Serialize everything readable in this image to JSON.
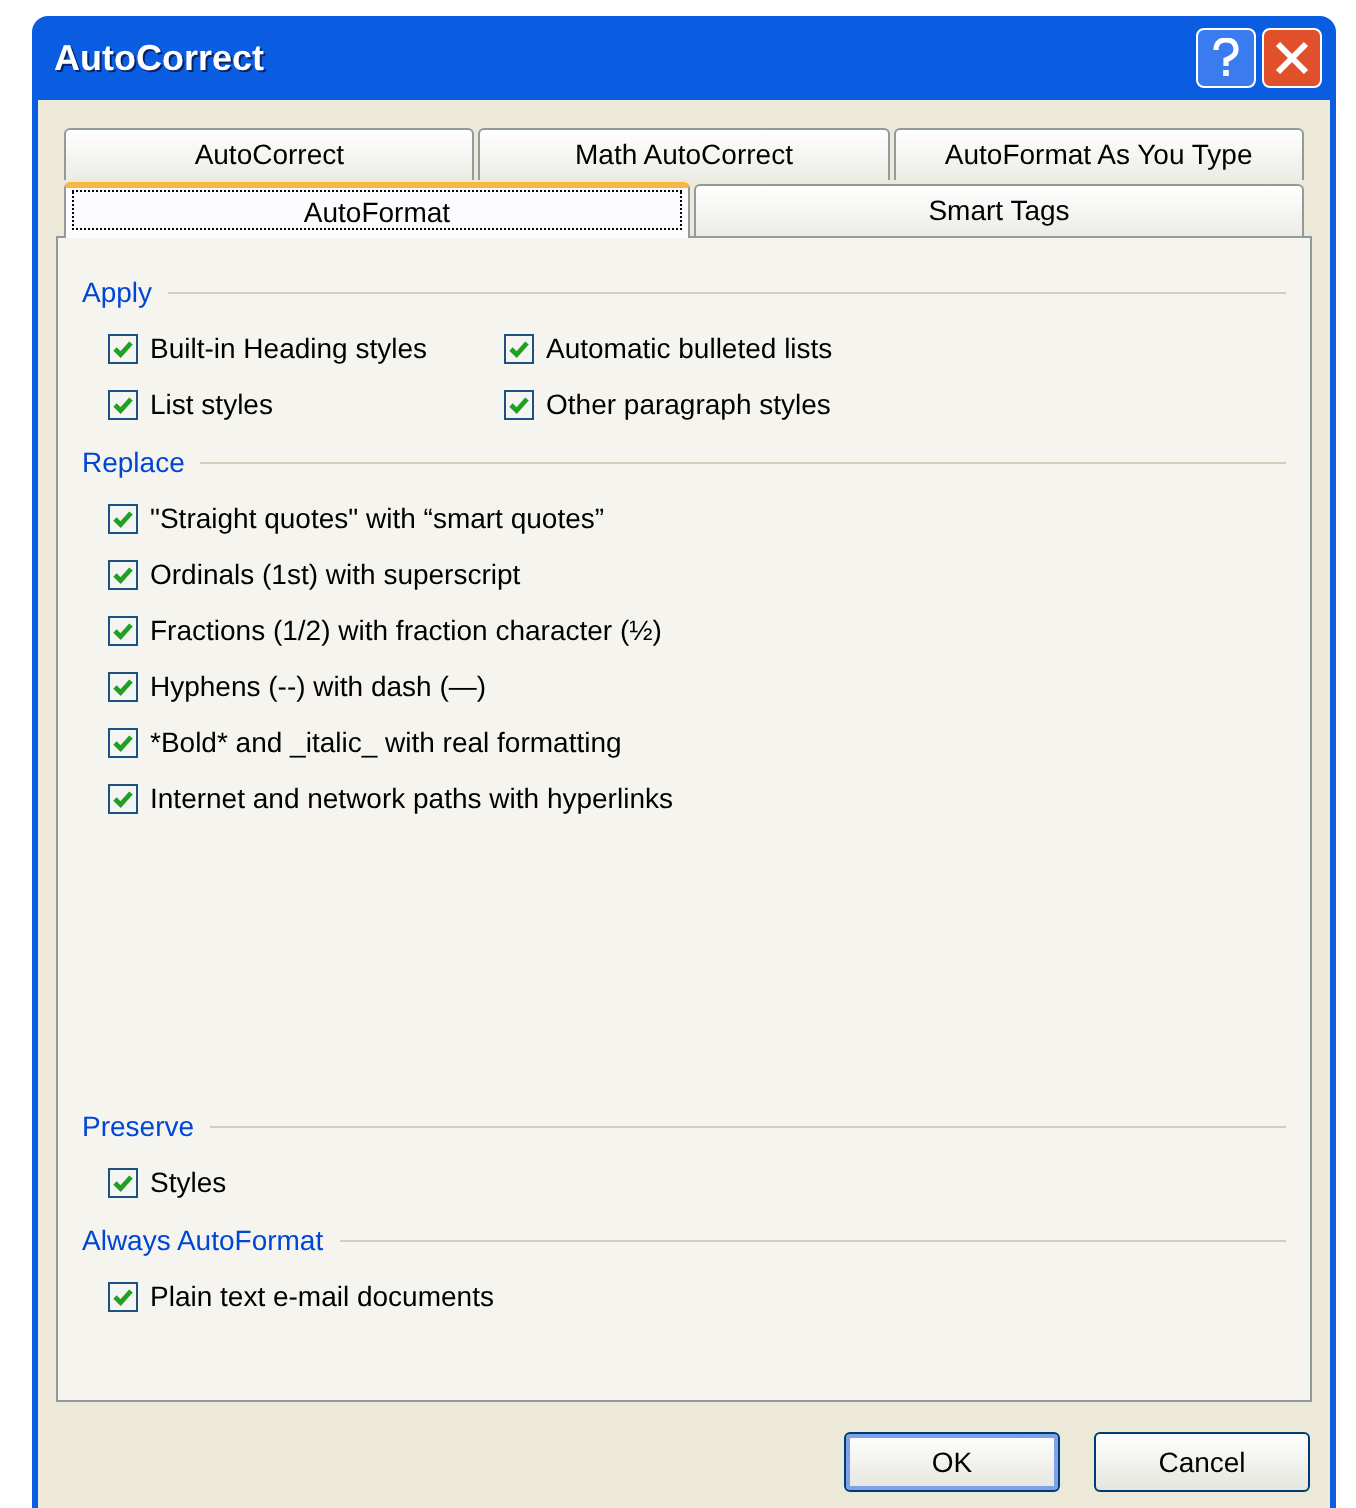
{
  "window": {
    "title": "AutoCorrect"
  },
  "tab_rows": [
    {
      "tabs": [
        {
          "label": "AutoCorrect",
          "selected": false
        },
        {
          "label": "Math AutoCorrect",
          "selected": false
        },
        {
          "label": "AutoFormat As You Type",
          "selected": false
        }
      ]
    },
    {
      "tabs": [
        {
          "label": "AutoFormat",
          "selected": true
        },
        {
          "label": "Smart Tags",
          "selected": false
        }
      ]
    }
  ],
  "sections": [
    {
      "title": "Apply",
      "kind": "two-column",
      "options": [
        {
          "label": "Built-in Heading styles",
          "checked": true
        },
        {
          "label": "Automatic bulleted lists",
          "checked": true
        },
        {
          "label": "List styles",
          "checked": true
        },
        {
          "label": "Other paragraph styles",
          "checked": true
        }
      ]
    },
    {
      "title": "Replace",
      "kind": "one-column",
      "options": [
        {
          "label": "\"Straight quotes\" with “smart quotes”",
          "checked": true
        },
        {
          "label": "Ordinals (1st) with superscript",
          "checked": true
        },
        {
          "label": "Fractions (1/2) with fraction character (½)",
          "checked": true
        },
        {
          "label": "Hyphens (--) with dash (—)",
          "checked": true
        },
        {
          "label": "*Bold* and _italic_ with real formatting",
          "checked": true
        },
        {
          "label": "Internet and network paths with hyperlinks",
          "checked": true
        }
      ]
    },
    {
      "title": "Preserve",
      "kind": "one-column",
      "options": [
        {
          "label": "Styles",
          "checked": true
        }
      ]
    },
    {
      "title": "Always AutoFormat",
      "kind": "one-column",
      "options": [
        {
          "label": "Plain text e-mail documents",
          "checked": true
        }
      ]
    }
  ],
  "buttons": [
    "OK",
    "Cancel"
  ]
}
